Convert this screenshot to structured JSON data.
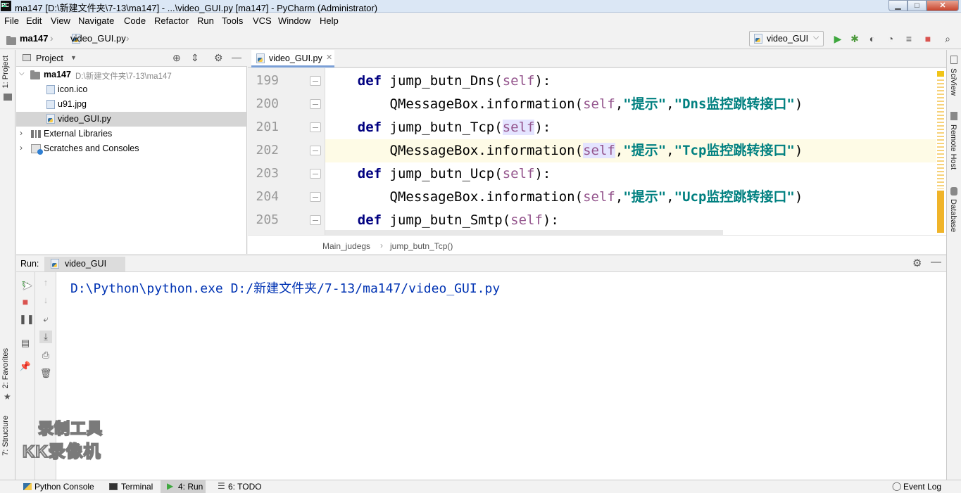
{
  "window": {
    "title": "ma147 [D:\\新建文件夹\\7-13\\ma147] - ...\\video_GUI.py [ma147] - PyCharm (Administrator)",
    "min_label": "▁",
    "max_label": "□",
    "close_label": "✕",
    "logo_text": "PC"
  },
  "menu": [
    "File",
    "Edit",
    "View",
    "Navigate",
    "Code",
    "Refactor",
    "Run",
    "Tools",
    "VCS",
    "Window",
    "Help"
  ],
  "navbar": {
    "project": "ma147",
    "file": "video_GUI.py",
    "run_config": "video_GUI"
  },
  "left_strip": {
    "project_tab": "1: Project",
    "favorites_tab": "2: Favorites",
    "structure_tab": "7: Structure"
  },
  "right_strip": {
    "sciview_tab": "SciView",
    "remote_host_tab": "Remote Host",
    "database_tab": "Database"
  },
  "project_panel": {
    "title": "Project",
    "root_name": "ma147",
    "root_path": "D:\\新建文件夹\\7-13\\ma147",
    "files": [
      "icon.ico",
      "u91.jpg",
      "video_GUI.py"
    ],
    "external_libraries": "External Libraries",
    "scratches": "Scratches and Consoles"
  },
  "editor": {
    "tab_label": "video_GUI.py",
    "lines": [
      {
        "num": "199",
        "def_kw": "def",
        "name": " jump_butn_Dns",
        "open": "(",
        "self": "self",
        "close": "):"
      },
      {
        "num": "200",
        "call": "QMessageBox.information(",
        "self": "self",
        "comma": ",",
        "title": "\"提示\"",
        "comma2": ",",
        "msg": "\"Dns监控跳转接口\"",
        "end": ")"
      },
      {
        "num": "201",
        "def_kw": "def",
        "name": " jump_butn_Tcp",
        "open": "(",
        "self": "self",
        "close": "):"
      },
      {
        "num": "202",
        "call": "QMessageBox.information(",
        "self": "self",
        "comma": ",",
        "title": "\"提示\"",
        "comma2": ",",
        "msg": "\"Tcp监控跳转接口\"",
        "end": ")"
      },
      {
        "num": "203",
        "def_kw": "def",
        "name": " jump_butn_Ucp",
        "open": "(",
        "self": "self",
        "close": "):"
      },
      {
        "num": "204",
        "call": "QMessageBox.information(",
        "self": "self",
        "comma": ",",
        "title": "\"提示\"",
        "comma2": ",",
        "msg": "\"Ucp监控跳转接口\"",
        "end": ")"
      },
      {
        "num": "205",
        "def_kw": "def",
        "name": " jump_butn_Smtp",
        "open": "(",
        "self": "self",
        "close": "):"
      }
    ],
    "breadcrumb": [
      "Main_judegs",
      "jump_butn_Tcp()"
    ],
    "breadcrumb_sep": "›"
  },
  "run_panel": {
    "label": "Run:",
    "tab": "video_GUI",
    "console_output": "D:\\Python\\python.exe D:/新建文件夹/7-13/ma147/video_GUI.py"
  },
  "statusbar": {
    "python_console": "Python Console",
    "terminal": "Terminal",
    "run": "4: Run",
    "todo": "6: TODO",
    "event_log": "Event Log"
  },
  "watermark": {
    "line1": "录制工具",
    "line2": "KK录像机"
  },
  "colors": {
    "keyword": "#000080",
    "self": "#94558d",
    "string": "#008080",
    "console_text": "#0033b3",
    "run_green": "#3ea73e",
    "stop_red": "#d9534f"
  }
}
